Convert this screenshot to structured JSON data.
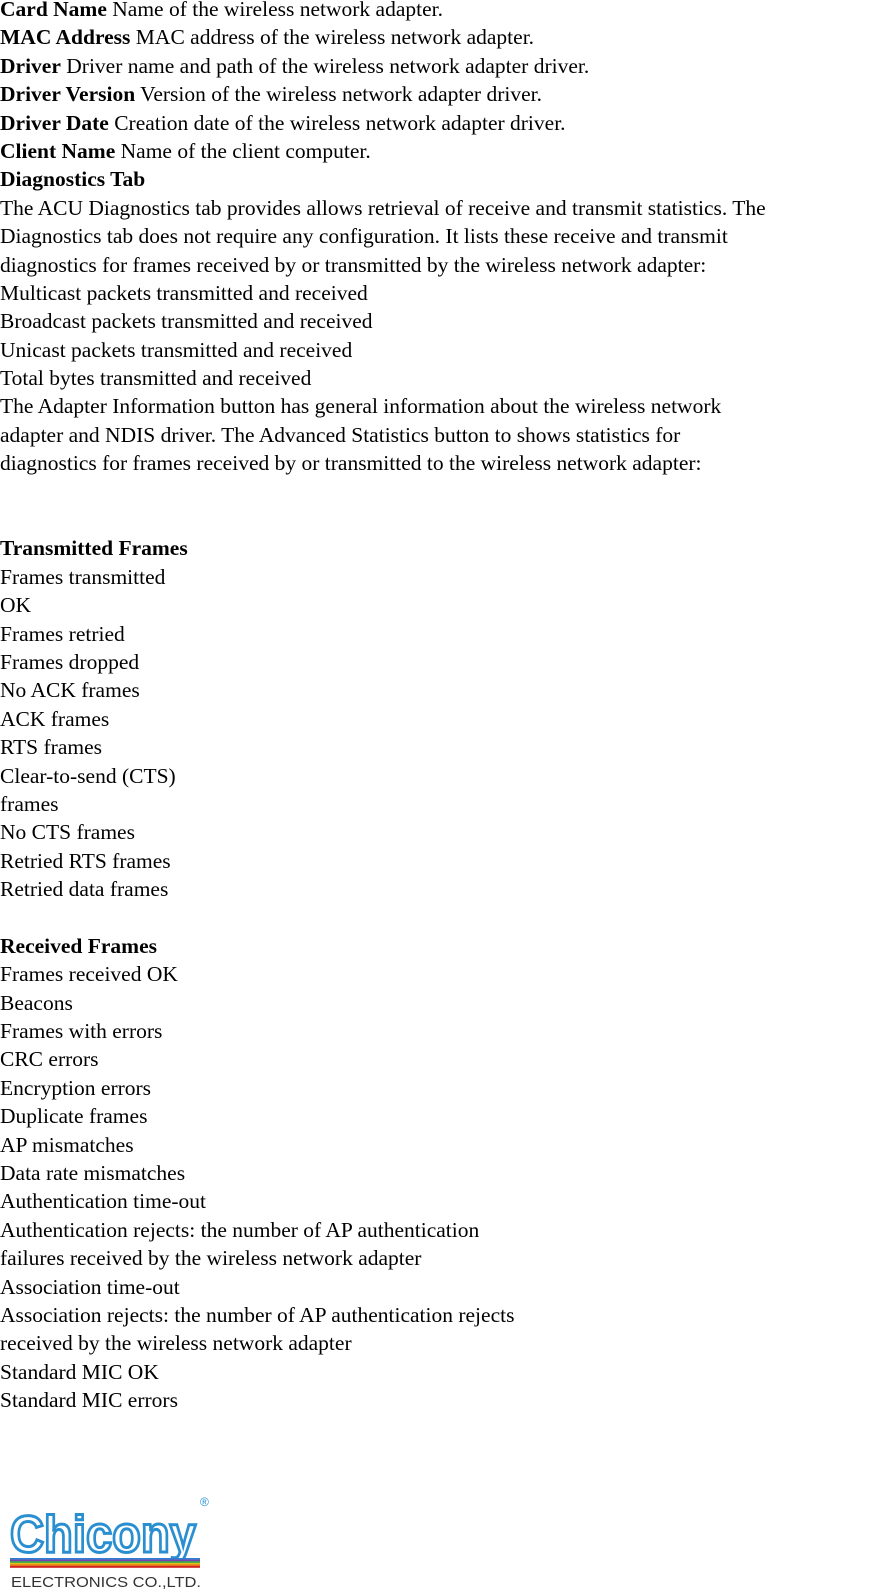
{
  "definitions": [
    {
      "term": "Card Name",
      "desc": "Name of the wireless network adapter."
    },
    {
      "term": "MAC Address",
      "desc": "MAC address of the wireless network adapter."
    },
    {
      "term": "Driver",
      "desc": "Driver name and path of the wireless network adapter driver."
    },
    {
      "term": "Driver Version",
      "desc": "Version of the wireless network adapter driver."
    },
    {
      "term": "Driver Date",
      "desc": "Creation date of the wireless network adapter driver."
    },
    {
      "term": "Client Name",
      "desc": "Name of the client computer."
    }
  ],
  "diagnostics": {
    "heading": "Diagnostics Tab",
    "intro_lines": [
      "The ACU Diagnostics tab provides allows retrieval of receive and transmit statistics. The",
      "Diagnostics tab does not require any configuration. It lists these receive and transmit",
      "diagnostics for frames received by or transmitted by the wireless network adapter:"
    ],
    "list": [
      "Multicast packets transmitted and received",
      "Broadcast packets transmitted and received",
      "Unicast packets transmitted and received",
      "Total bytes transmitted and received"
    ],
    "outro_lines": [
      "The Adapter Information button has general information about the wireless network",
      "adapter and NDIS driver. The Advanced Statistics button to shows statistics for",
      "diagnostics for frames received by or transmitted to the wireless network adapter:"
    ]
  },
  "transmitted": {
    "heading": "Transmitted Frames",
    "lines": [
      "Frames transmitted",
      "OK",
      "Frames retried",
      "Frames dropped",
      "No ACK frames",
      "ACK frames",
      "RTS frames",
      "Clear-to-send (CTS)",
      "frames",
      "No CTS frames",
      "Retried RTS frames",
      "Retried data frames"
    ]
  },
  "received": {
    "heading": "Received Frames",
    "lines": [
      "Frames received OK",
      "Beacons",
      "Frames with errors",
      "CRC errors",
      "Encryption errors",
      "Duplicate frames",
      "AP mismatches",
      "Data rate mismatches",
      "Authentication time-out",
      "Authentication rejects: the number of AP authentication",
      "failures received by the wireless network adapter",
      "Association time-out",
      "Association rejects: the number of AP authentication rejects",
      "received by the wireless network adapter",
      "Standard MIC OK",
      "Standard MIC errors"
    ]
  },
  "logo": {
    "brand": "Chicony",
    "registered": "®",
    "subtitle": "ELECTRONICS CO.,LTD.",
    "brand_color": "#2a8fd0",
    "subtitle_color": "#333333",
    "stripe_colors": [
      "#2f7fd0",
      "#7a3fb0",
      "#2fa84a",
      "#e0c020",
      "#e8701a",
      "#d02020"
    ]
  }
}
